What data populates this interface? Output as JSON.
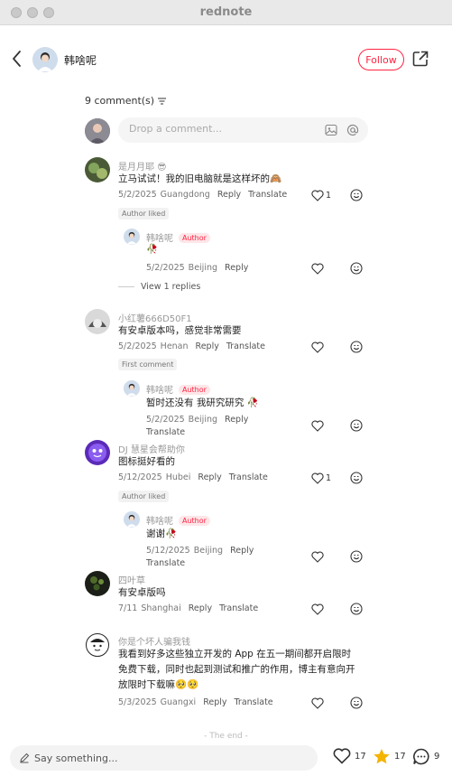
{
  "window": {
    "title": "rednote"
  },
  "header": {
    "author_name": "韩啥呢",
    "follow_label": "Follow"
  },
  "comments_section": {
    "count_label": "9 comment(s)",
    "input_placeholder": "Drop a comment..."
  },
  "comments": [
    {
      "name": "是月月耶 😎",
      "text": "立马试试！我的旧电脑就是这样坏的🙈",
      "date": "5/2/2025",
      "location": "Guangdong",
      "reply": "Reply",
      "translate": "Translate",
      "likes": "1",
      "badge": "Author liked",
      "replies": [
        {
          "name": "韩啥呢",
          "author_badge": "Author",
          "text": "🥀",
          "date": "5/2/2025",
          "location": "Beijing",
          "reply": "Reply"
        }
      ],
      "view_replies": "View 1 replies"
    },
    {
      "name": "小红薯666D50F1",
      "text": "有安卓版本吗，感觉非常需要",
      "date": "5/2/2025",
      "location": "Henan",
      "reply": "Reply",
      "translate": "Translate",
      "badge": "First comment",
      "replies": [
        {
          "name": "韩啥呢",
          "author_badge": "Author",
          "text": "暂时还没有 我研究研究 🥀",
          "date": "5/2/2025",
          "location": "Beijing",
          "reply": "Reply",
          "translate": "Translate"
        }
      ]
    },
    {
      "name": "DJ 慧星会帮助你",
      "text": "图标挺好看的",
      "date": "5/12/2025",
      "location": "Hubei",
      "reply": "Reply",
      "translate": "Translate",
      "likes": "1",
      "badge": "Author liked",
      "replies": [
        {
          "name": "韩啥呢",
          "author_badge": "Author",
          "text": "谢谢🥀",
          "date": "5/12/2025",
          "location": "Beijing",
          "reply": "Reply",
          "translate": "Translate"
        }
      ]
    },
    {
      "name": "四叶草",
      "text": "有安卓版吗",
      "date": "7/11",
      "location": "Shanghai",
      "reply": "Reply",
      "translate": "Translate"
    },
    {
      "name": "你是个坏人骗我钱",
      "text_lines": [
        "我看到好多这些独立开发的 App 在五一期间都开启限时",
        "免费下载，同时也起到测试和推广的作用，博主有意向开",
        "放限时下载嘛🥺🥺"
      ],
      "date": "5/3/2025",
      "location": "Guangxi",
      "reply": "Reply",
      "translate": "Translate"
    }
  ],
  "footer": {
    "the_end": "- The end -"
  },
  "bottom_bar": {
    "say_placeholder": "Say something...",
    "likes": "17",
    "collects": "17",
    "comments": "9"
  },
  "colors": {
    "accent": "#ff2442",
    "star": "#f5b400"
  }
}
